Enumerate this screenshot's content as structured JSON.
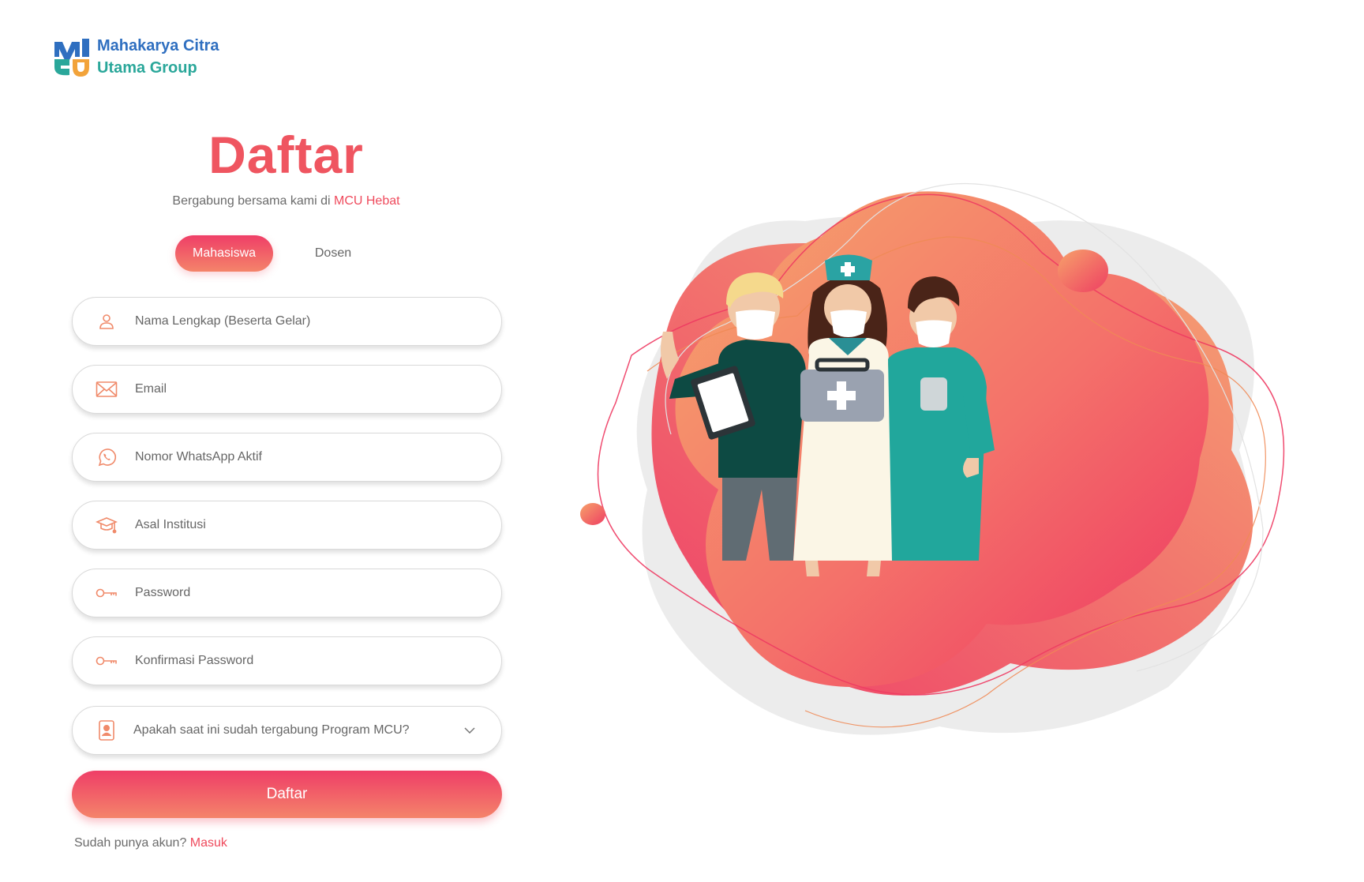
{
  "brand": {
    "name_line1": "Mahakarya Citra",
    "name_line2": "Utama Group",
    "colors": {
      "blue": "#2f6fc0",
      "teal": "#2aa79a",
      "orange": "#f2a33a"
    }
  },
  "form": {
    "title": "Daftar",
    "subtitle_prefix": "Bergabung bersama kami di ",
    "subtitle_highlight": "MCU Hebat",
    "tabs": [
      {
        "label": "Mahasiswa",
        "active": true
      },
      {
        "label": "Dosen",
        "active": false
      }
    ],
    "fields": {
      "full_name": {
        "placeholder": "Nama Lengkap (Beserta Gelar)",
        "value": "",
        "icon": "user-icon"
      },
      "email": {
        "placeholder": "Email",
        "value": "",
        "icon": "mail-icon"
      },
      "whatsapp": {
        "placeholder": "Nomor WhatsApp Aktif",
        "value": "",
        "icon": "whatsapp-icon"
      },
      "institution": {
        "placeholder": "Asal Institusi",
        "value": "",
        "icon": "graduation-cap-icon"
      },
      "password": {
        "placeholder": "Password",
        "value": "",
        "icon": "key-icon"
      },
      "confirm_password": {
        "placeholder": "Konfirmasi Password",
        "value": "",
        "icon": "key-icon"
      },
      "mcu_program": {
        "selected": "Apakah saat ini sudah tergabung Program MCU?",
        "icon": "id-badge-icon"
      }
    },
    "submit_label": "Daftar",
    "login_prompt": "Sudah punya akun? ",
    "login_link": "Masuk"
  },
  "theme": {
    "accent": "#ef4a5c",
    "gradient_start": "#ef3e67",
    "gradient_end": "#f4846a"
  }
}
